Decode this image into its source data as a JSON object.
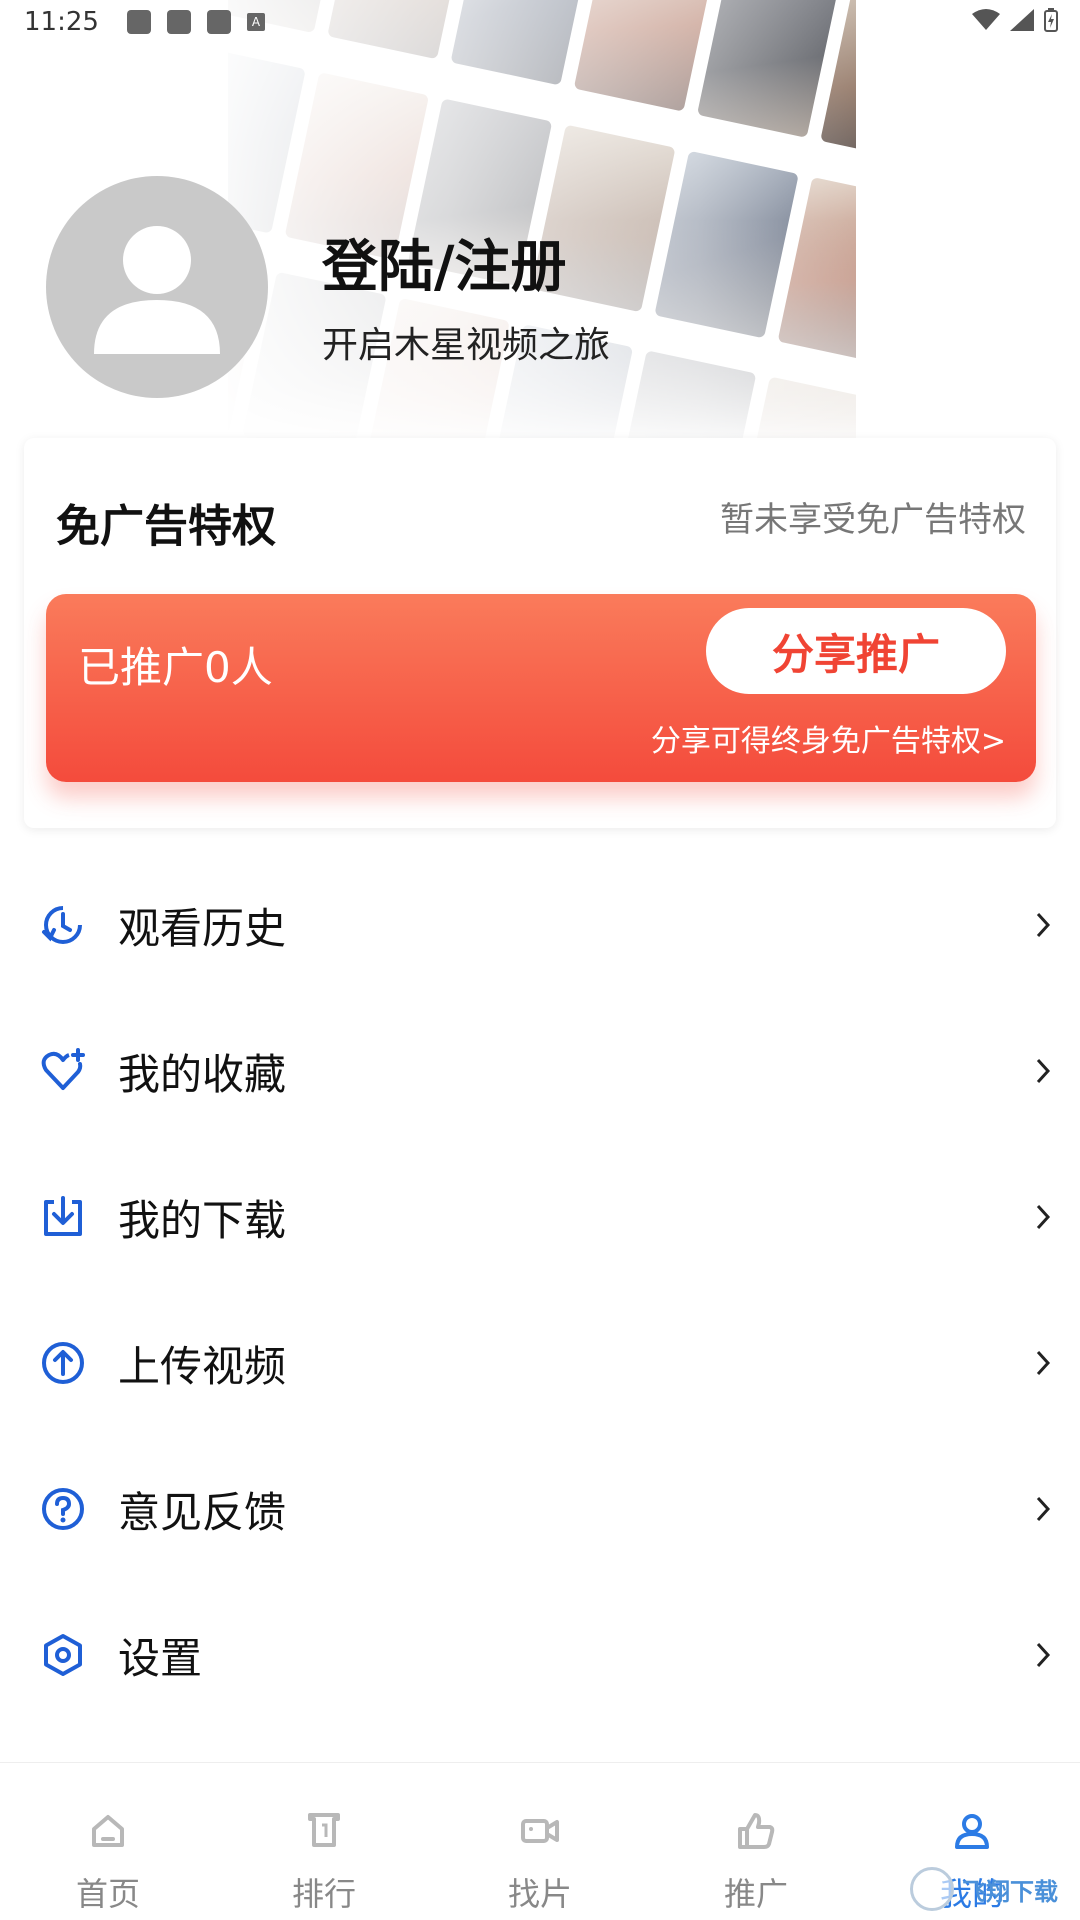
{
  "status_bar": {
    "time": "11:25",
    "notification_badge": "A"
  },
  "profile": {
    "title": "登陆/注册",
    "subtitle": "开启木星视频之旅"
  },
  "ad_free": {
    "title": "免广告特权",
    "status": "暂未享受免广告特权",
    "promo_count": "已推广0人",
    "share_button": "分享推广",
    "share_hint": "分享可得终身免广告特权>"
  },
  "menu": {
    "items": [
      {
        "label": "观看历史",
        "icon": "history-icon"
      },
      {
        "label": "我的收藏",
        "icon": "favorite-heart-icon"
      },
      {
        "label": "我的下载",
        "icon": "download-icon"
      },
      {
        "label": "上传视频",
        "icon": "upload-icon"
      },
      {
        "label": "意见反馈",
        "icon": "feedback-question-icon"
      },
      {
        "label": "设置",
        "icon": "settings-icon"
      }
    ]
  },
  "bottom_nav": {
    "items": [
      {
        "label": "首页",
        "icon": "home-icon"
      },
      {
        "label": "排行",
        "icon": "ranking-icon"
      },
      {
        "label": "找片",
        "icon": "video-camera-icon"
      },
      {
        "label": "推广",
        "icon": "thumbs-up-icon"
      },
      {
        "label": "我的",
        "icon": "user-icon",
        "active": true
      }
    ]
  },
  "watermark": {
    "text": "飞翔下载"
  },
  "colors": {
    "accent": "#2C7BE5",
    "icon_blue": "#1F5FD6",
    "promo_red": "#F44B3C",
    "promo_orange": "#FA7B5B",
    "avatar_gray": "#C9C9C9"
  }
}
